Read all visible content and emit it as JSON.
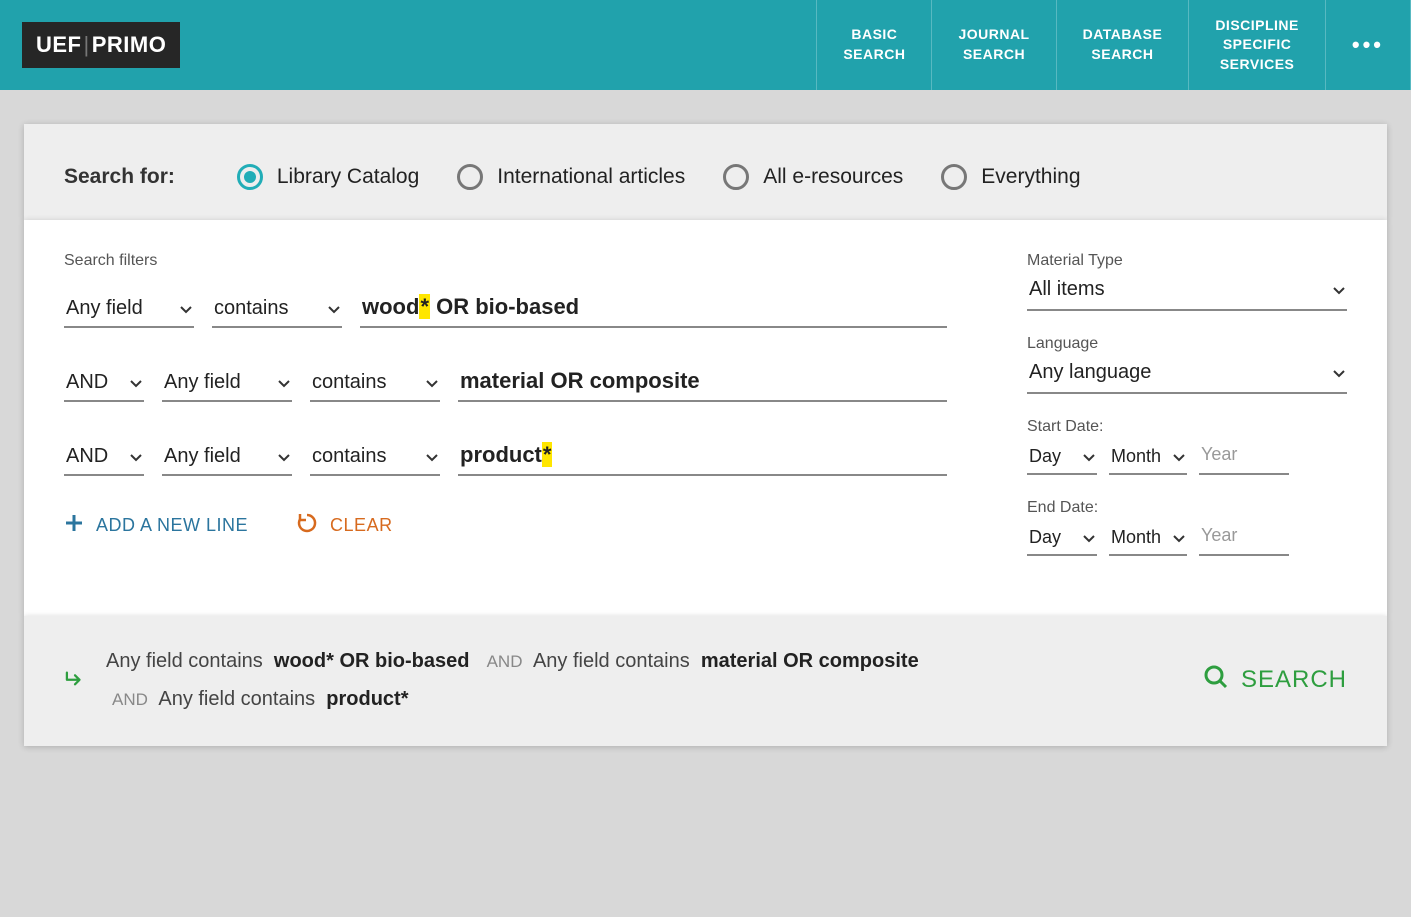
{
  "logo": {
    "uef": "UEF",
    "primo": "PRIMO"
  },
  "nav": {
    "basic": {
      "l1": "BASIC",
      "l2": "SEARCH"
    },
    "journal": {
      "l1": "JOURNAL",
      "l2": "SEARCH"
    },
    "database": {
      "l1": "DATABASE",
      "l2": "SEARCH"
    },
    "discipline": {
      "l1": "DISCIPLINE",
      "l2": "SPECIFIC",
      "l3": "SERVICES"
    },
    "more": "•••"
  },
  "scope": {
    "label": "Search for:",
    "options": {
      "catalog": "Library Catalog",
      "intl": "International articles",
      "eres": "All e-resources",
      "every": "Everything"
    }
  },
  "filters": {
    "label": "Search filters",
    "row1": {
      "field": "Any field",
      "op": "contains",
      "prefix": "wood",
      "hl": "*",
      "suffix": " OR bio-based"
    },
    "row2": {
      "bool": "AND",
      "field": "Any field",
      "op": "contains",
      "val": "material OR composite"
    },
    "row3": {
      "bool": "AND",
      "field": "Any field",
      "op": "contains",
      "prefix": "product",
      "hl": "*"
    }
  },
  "side": {
    "material": {
      "label": "Material Type",
      "value": "All items"
    },
    "language": {
      "label": "Language",
      "value": "Any language"
    },
    "start": {
      "label": "Start Date:",
      "day": "Day",
      "month": "Month",
      "year": "Year"
    },
    "end": {
      "label": "End Date:",
      "day": "Day",
      "month": "Month",
      "year": "Year"
    }
  },
  "actions": {
    "add": "ADD A NEW LINE",
    "clear": "CLEAR"
  },
  "footer": {
    "f1": "Any field",
    "c1": "contains",
    "v1": "wood* OR bio-based",
    "and1": "AND",
    "f2": "Any field",
    "c2": "contains",
    "v2": "material OR composite",
    "and2": "AND",
    "f3": "Any field",
    "c3": "contains",
    "v3": "product*",
    "search": "SEARCH"
  }
}
